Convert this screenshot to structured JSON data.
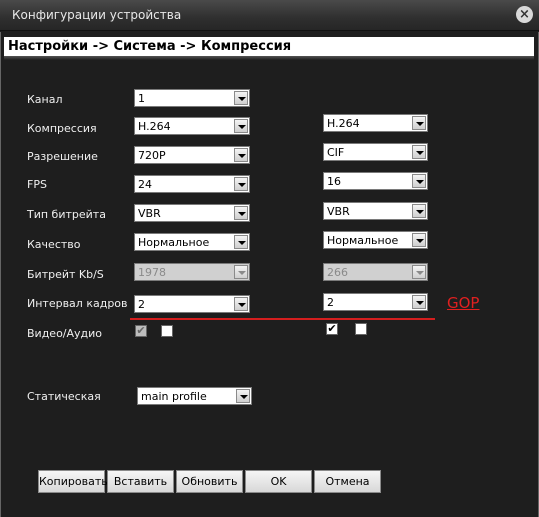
{
  "window": {
    "title": "Конфигурации устройства"
  },
  "breadcrumb": "Настройки -> Система -> Компрессия",
  "fields": {
    "channel": {
      "label": "Канал",
      "value": "1"
    },
    "compression": {
      "label": "Компрессия",
      "main": "H.264",
      "sub": "H.264"
    },
    "resolution": {
      "label": "Разрешение",
      "main": "720P",
      "sub": "CIF"
    },
    "fps": {
      "label": "FPS",
      "main": "24",
      "sub": "16"
    },
    "bitrate_type": {
      "label": "Тип битрейта",
      "main": "VBR",
      "sub": "VBR"
    },
    "quality": {
      "label": "Качество",
      "main": "Нормальное",
      "sub": "Нормальное"
    },
    "bitrate": {
      "label": "Битрейт Kb/S",
      "main": "1978",
      "sub": "266"
    },
    "frame_interval": {
      "label": "Интервал кадров",
      "main": "2",
      "sub": "2"
    },
    "video_audio": {
      "label": "Видео/Аудио",
      "main_video": "✔",
      "main_audio": "",
      "sub_video": "✔",
      "sub_audio": ""
    },
    "static": {
      "label": "Статическая",
      "value": "main profile"
    }
  },
  "annotation": {
    "gop_text": "GOP",
    "color": "#d41e1e"
  },
  "buttons": {
    "copy": "Копировать",
    "paste": "Вставить",
    "refresh": "Обновить",
    "ok": "OK",
    "cancel": "Отмена"
  },
  "colors": {
    "background": "#1e1e1e",
    "field": "#ffffff",
    "disabled_field": "#d0d0d0"
  },
  "icons": {
    "close": "close-icon",
    "dropdown": "chevron-down-icon"
  }
}
